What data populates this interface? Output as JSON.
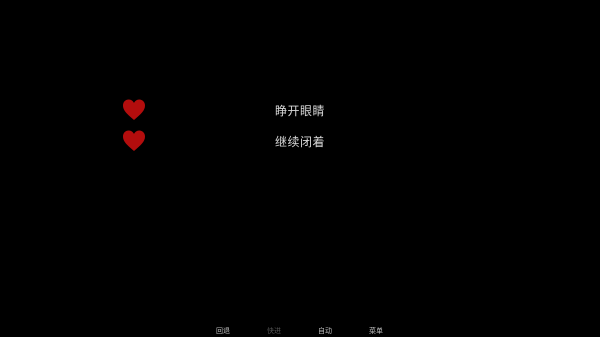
{
  "choices": [
    {
      "label": "睁开眼睛",
      "icon": "heart-icon"
    },
    {
      "label": "继续闭着",
      "icon": "heart-icon"
    }
  ],
  "quick_menu": {
    "back": "回退",
    "skip": "快进",
    "auto": "自动",
    "menu": "菜单"
  },
  "colors": {
    "background": "#000000",
    "heart": "#b30d0d",
    "choice_text": "#d9d9d9",
    "menu_text": "#bfbfbf",
    "menu_text_disabled": "#555555"
  }
}
